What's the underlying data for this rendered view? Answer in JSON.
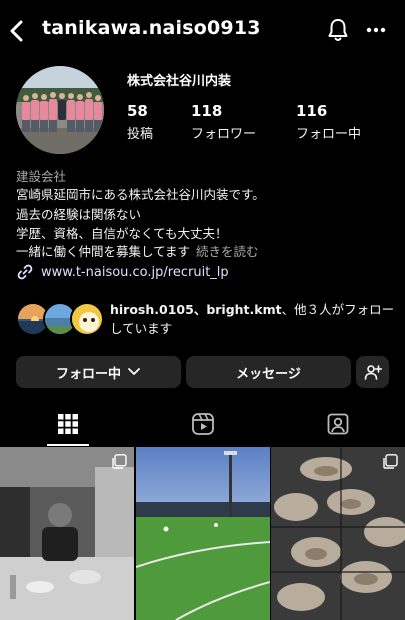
{
  "header": {
    "username": "tanikawa.naiso0913",
    "icons": [
      "back-icon",
      "bell-icon",
      "more-icon"
    ]
  },
  "profile": {
    "name": "株式会社谷川内装",
    "stats": [
      {
        "num": "58",
        "label": "投稿"
      },
      {
        "num": "118",
        "label": "フォロワー"
      },
      {
        "num": "116",
        "label": "フォロー中"
      }
    ],
    "category": "建設会社",
    "bio": [
      "宮崎県延岡市にある株式会社谷川内装です。",
      "過去の経験は関係ない",
      "学歴、資格、自信がなくても大丈夫！",
      "一緒に働く仲間を募集してます"
    ],
    "more_label": "続きを読む",
    "link": "www.t-naisou.co.jp/recruit_lp"
  },
  "mutual": {
    "names": "hirosh.0105、bright.kmt",
    "rest": "、他３人がフォローしています"
  },
  "buttons": {
    "following": "フォロー中",
    "message": "メッセージ"
  },
  "tabs": [
    "grid-icon",
    "reels-icon",
    "tagged-icon"
  ],
  "colors": {
    "background": "#000000",
    "button": "#262626",
    "link": "#d8e2ff",
    "muted": "#a8a8a8"
  }
}
